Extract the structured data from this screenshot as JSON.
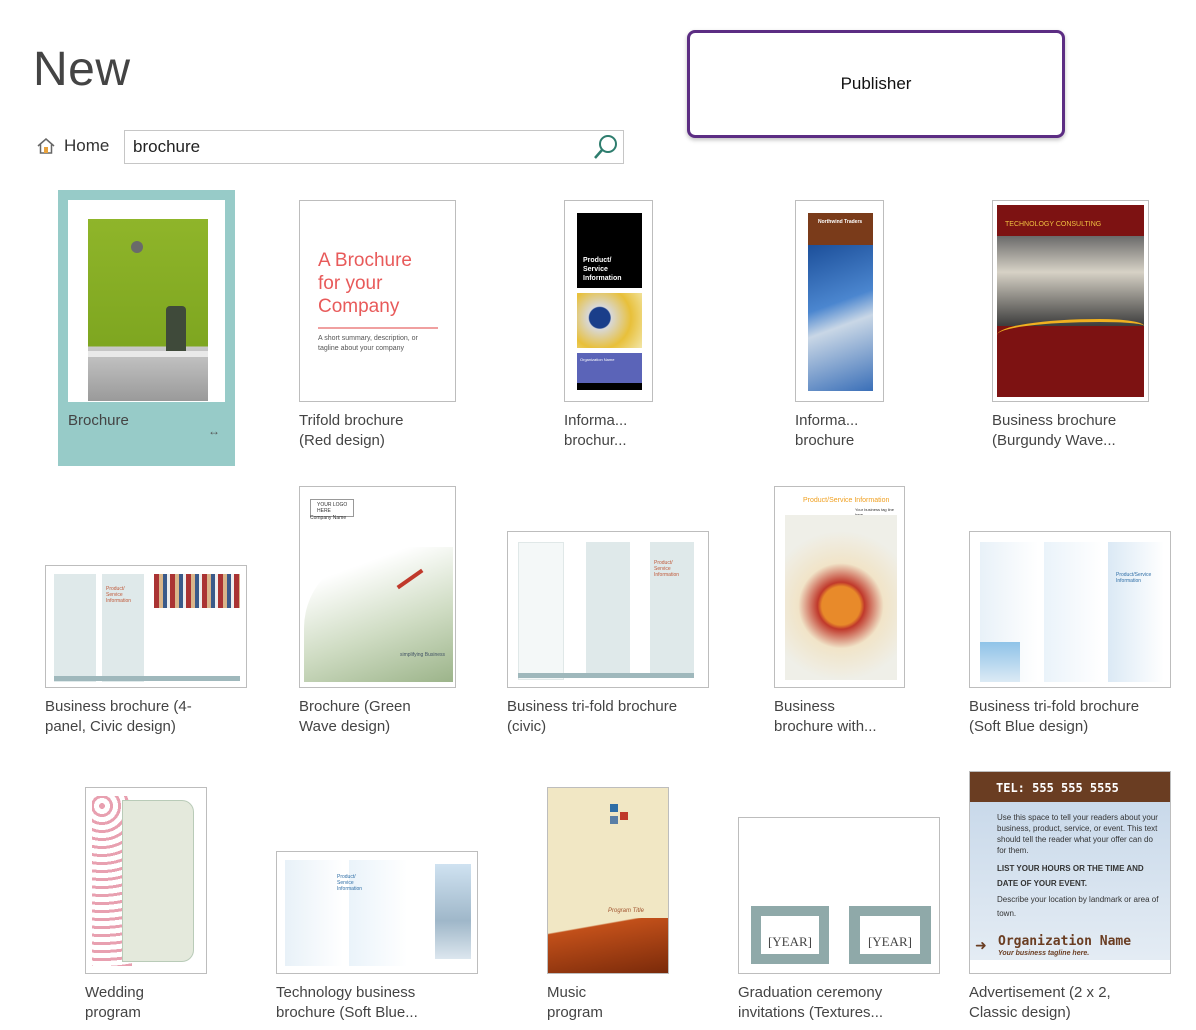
{
  "page": {
    "title": "New"
  },
  "app_label": "Publisher",
  "nav": {
    "home_label": "Home"
  },
  "search": {
    "value": "brochure"
  },
  "templates": [
    {
      "label": "Brochure",
      "thumb_text": ""
    },
    {
      "label": "Trifold brochure\n(Red design)",
      "thumb_text": "A Brochure\nfor your\nCompany",
      "thumb_sub": "A short summary, description, or\ntagline about your company"
    },
    {
      "label": "Informa...\nbrochur...",
      "thumb_text": "Product/\nService\nInformation",
      "thumb_sub": "Organization Name"
    },
    {
      "label": "Informa...\nbrochure",
      "thumb_text": "Northwind Traders"
    },
    {
      "label": "Business brochure\n(Burgundy Wave...",
      "thumb_text": "TECHNOLOGY CONSULTING"
    },
    {
      "label": "Business brochure (4-\npanel, Civic design)",
      "thumb_text": "Product/\nService\nInformation"
    },
    {
      "label": "Brochure (Green\nWave design)",
      "thumb_text": "YOUR LOGO\nHERE",
      "thumb_sub": "Company Name",
      "thumb_foot": "simplifying Business"
    },
    {
      "label": "Business tri-fold brochure\n(civic)",
      "thumb_text": "Product/\nService\nInformation"
    },
    {
      "label": "Business\nbrochure with...",
      "thumb_text": "Product/Service Information",
      "thumb_sub": "Your business tag line here."
    },
    {
      "label": "Business tri-fold brochure\n(Soft Blue design)",
      "thumb_text": "Product/Service\nInformation"
    },
    {
      "label": "Wedding\nprogram",
      "thumb_text": ""
    },
    {
      "label": "Technology business\nbrochure (Soft Blue...",
      "thumb_text": "Product/\nService\nInformation"
    },
    {
      "label": "Music\nprogram",
      "thumb_text": "Program Title"
    },
    {
      "label": "Graduation ceremony\ninvitations (Textures...",
      "thumb_text": "[YEAR]"
    },
    {
      "label": "Advertisement (2 x 2,\nClassic design)",
      "thumb_text": "TEL: 555 555 5555",
      "thumb_sub": "Use this space to tell your readers about your business, product, service, or event. This text should tell the reader what your offer can do for them.",
      "thumb_mid": "LIST YOUR HOURS OR THE TIME AND DATE OF YOUR EVENT.",
      "thumb_small": "Describe your location by landmark or area of town.",
      "thumb_org": "Organization Name",
      "thumb_tag": "Your business tagline here."
    }
  ],
  "colors": {
    "selected_bg": "#97cbc8",
    "accent": "#5c2d83"
  }
}
